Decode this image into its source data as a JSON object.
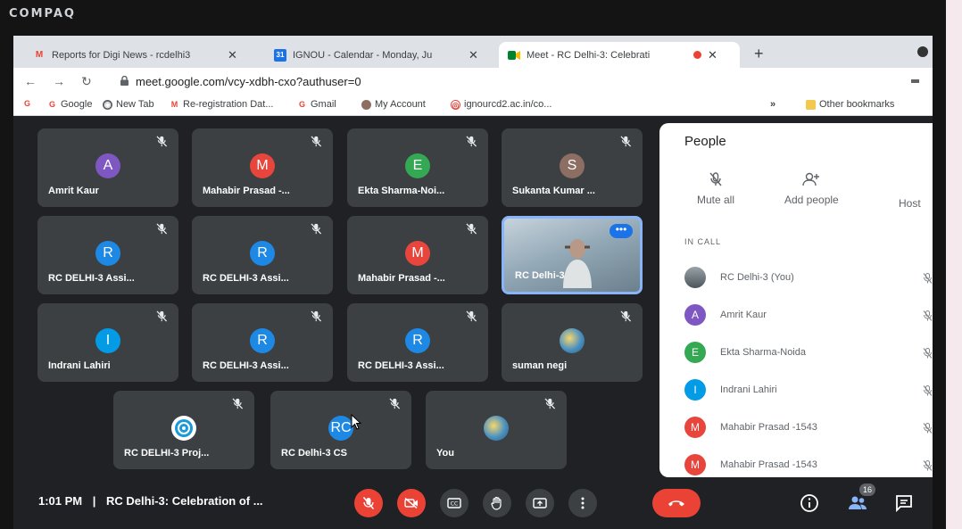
{
  "monitor": {
    "brand": "COMPAQ"
  },
  "browser": {
    "tabs": [
      {
        "title": "Reports for Digi News - rcdelhi3",
        "favicon": "gmail-icon"
      },
      {
        "title": "IGNOU - Calendar - Monday, Ju",
        "favicon": "calendar-icon"
      },
      {
        "title": "Meet - RC Delhi-3: Celebrati",
        "favicon": "meet-icon",
        "active": true
      }
    ],
    "url": "meet.google.com/vcy-xdbh-cxo?authuser=0",
    "bookmarks": [
      "Google",
      "New Tab",
      "Re-registration Dat...",
      "Gmail",
      "My Account",
      "ignourcd2.ac.in/co..."
    ],
    "other_bookmarks": "Other bookmarks",
    "overflow": "»"
  },
  "meet": {
    "tiles": [
      {
        "name": "Amrit Kaur",
        "initial": "A",
        "color": "#7e57c2"
      },
      {
        "name": "Mahabir Prasad -...",
        "initial": "M",
        "color": "#e8453c"
      },
      {
        "name": "Ekta Sharma-Noi...",
        "initial": "E",
        "color": "#34a853"
      },
      {
        "name": "Sukanta Kumar ...",
        "initial": "S",
        "color": "#8d6e63"
      },
      {
        "name": "RC DELHI-3 Assi...",
        "initial": "R",
        "color": "#1e88e5"
      },
      {
        "name": "RC DELHI-3 Assi...",
        "initial": "R",
        "color": "#1e88e5"
      },
      {
        "name": "Mahabir Prasad -...",
        "initial": "M",
        "color": "#e8453c"
      },
      {
        "name": "RC Delhi-3",
        "video": true
      },
      {
        "name": "Indrani Lahiri",
        "initial": "I",
        "color": "#039be5"
      },
      {
        "name": "RC DELHI-3 Assi...",
        "initial": "R",
        "color": "#1e88e5"
      },
      {
        "name": "RC DELHI-3 Assi...",
        "initial": "R",
        "color": "#1e88e5"
      },
      {
        "name": "suman negi",
        "photo": true
      },
      {
        "name": "RC DELHI-3 Proj...",
        "logo": true
      },
      {
        "name": "RC Delhi-3 CS",
        "initial": "RC",
        "color": "#1e88e5"
      },
      {
        "name": "You",
        "photo": true
      }
    ],
    "time": "1:01 PM",
    "separator": "|",
    "meeting_title": "RC Delhi-3: Celebration of ...",
    "participant_count": "16"
  },
  "people_panel": {
    "title": "People",
    "mute_all": "Mute all",
    "add_people": "Add people",
    "host": "Host",
    "section": "IN CALL",
    "participants": [
      {
        "name": "RC Delhi-3 (You)",
        "photo": true
      },
      {
        "name": "Amrit Kaur",
        "initial": "A",
        "color": "#7e57c2"
      },
      {
        "name": "Ekta Sharma-Noida",
        "initial": "E",
        "color": "#34a853"
      },
      {
        "name": "Indrani Lahiri",
        "initial": "I",
        "color": "#039be5"
      },
      {
        "name": "Mahabir Prasad -1543",
        "initial": "M",
        "color": "#e8453c"
      },
      {
        "name": "Mahabir Prasad -1543",
        "initial": "M",
        "color": "#e8453c"
      }
    ]
  },
  "colors": {
    "meet_bg": "#202124",
    "tile_bg": "#3c4043",
    "danger": "#ea4335",
    "control": "#3c4043"
  }
}
